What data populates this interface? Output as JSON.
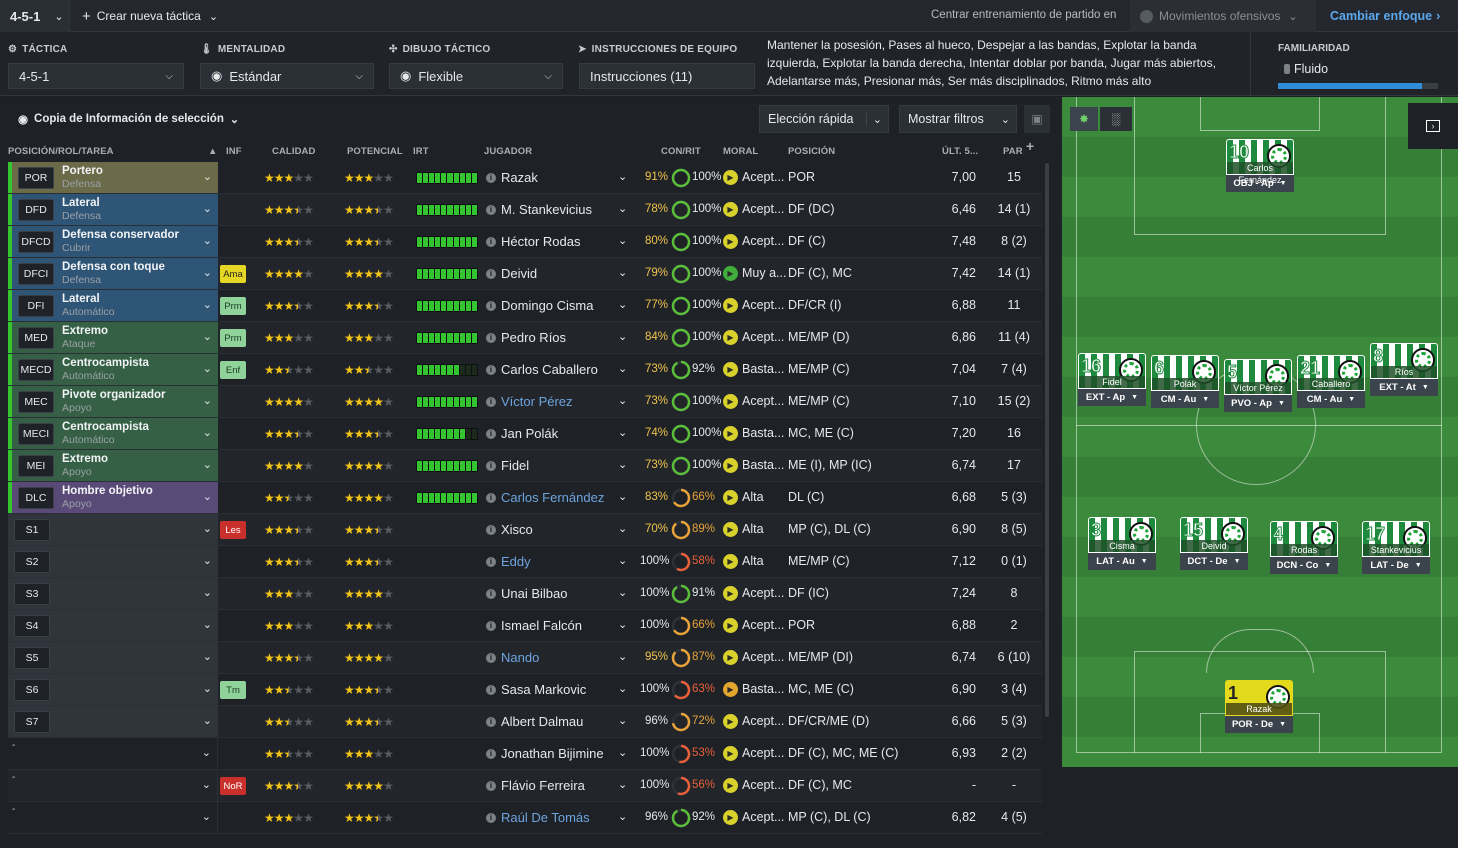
{
  "topbar": {
    "tactic_selected": "4-5-1",
    "create_new": "Crear nueva táctica",
    "match_training_label": "Centrar entrenamiento de partido en",
    "match_training_value": "Movimientos ofensivos",
    "change_focus": "Cambiar enfoque"
  },
  "tactic_nav": {
    "tactic_label": "TÁCTICA",
    "tactic_value": "4-5-1",
    "mentality_label": "MENTALIDAD",
    "mentality_value": "Estándar",
    "shape_label": "DIBUJO TÁCTICO",
    "shape_value": "Flexible",
    "instructions_label": "INSTRUCCIONES DE EQUIPO",
    "instructions_value": "Instrucciones (11)",
    "instructions_summary": "Mantener la posesión, Pases al hueco, Despejar a las bandas, Explotar la banda izquierda, Explotar la banda derecha, Intentar doblar por banda, Jugar más abiertos, Adelantarse más, Presionar más, Ser más disciplinados, Ritmo más alto",
    "familiarity_label": "FAMILIARIDAD",
    "familiarity_value": "Fluido",
    "familiarity_level": 0.9
  },
  "toolbar": {
    "copy_info": "Copia de Información de selección",
    "quick_pick": "Elección rápida",
    "show_filters": "Mostrar filtros"
  },
  "columns": {
    "role": "POSICIÓN/ROL/TAREA",
    "inf": "INF",
    "calidad": "CALIDAD",
    "potencial": "POTENCIAL",
    "irt": "IRT",
    "jugador": "JUGADOR",
    "con_rit": "CON/RIT",
    "moral": "MORAL",
    "posicion": "POSICIÓN",
    "ult5": "ÚLT. 5...",
    "par": "PAR"
  },
  "colors": {
    "gk": "#6b6a49",
    "def": "#2e5476",
    "mid": "#356046",
    "att": "#5a4a78",
    "sub": "#30353b",
    "stars": "#f2c318",
    "irt_bar": "#34c431",
    "link": "#6ea4de",
    "familiarity": "#2e8fd6"
  },
  "rows": [
    {
      "code": "POR",
      "role": "Portero",
      "duty": "Defensa",
      "group": "gk",
      "inf": "",
      "qual": 3,
      "pot": 3,
      "irt": 10,
      "name": "Razak",
      "link": false,
      "cond": "91%",
      "cond_c": "#f0c34a",
      "moral": "100%",
      "moral_c": "#5cbf3a",
      "mood": "Acept...",
      "mood_c": "#d9d12b",
      "pos": "POR",
      "ult": "7,00",
      "par": "15"
    },
    {
      "code": "DFD",
      "role": "Lateral",
      "duty": "Defensa",
      "group": "def",
      "inf": "",
      "qual": 3.5,
      "pot": 3.5,
      "irt": 10,
      "name": "M. Stankevicius",
      "link": false,
      "cond": "78%",
      "cond_c": "#f0c34a",
      "moral": "100%",
      "moral_c": "#5cbf3a",
      "mood": "Acept...",
      "mood_c": "#d9d12b",
      "pos": "DF (DC)",
      "ult": "6,46",
      "par": "14 (1)"
    },
    {
      "code": "DFCD",
      "role": "Defensa conservador",
      "duty": "Cubrir",
      "group": "def",
      "inf": "",
      "qual": 3.5,
      "pot": 3.5,
      "irt": 10,
      "name": "Héctor Rodas",
      "link": false,
      "cond": "80%",
      "cond_c": "#f0c34a",
      "moral": "100%",
      "moral_c": "#5cbf3a",
      "mood": "Acept...",
      "mood_c": "#d9d12b",
      "pos": "DF (C)",
      "ult": "7,48",
      "par": "8 (2)"
    },
    {
      "code": "DFCI",
      "role": "Defensa con toque",
      "duty": "Defensa",
      "group": "def",
      "inf": "Ama",
      "inf_bg": "#e6d725",
      "inf_c": "#222",
      "qual": 4,
      "pot": 4,
      "irt": 10,
      "name": "Deivid",
      "link": false,
      "cond": "79%",
      "cond_c": "#f0c34a",
      "moral": "100%",
      "moral_c": "#5cbf3a",
      "mood": "Muy a...",
      "mood_c": "#3fae3a",
      "pos": "DF (C), MC",
      "ult": "7,42",
      "par": "14 (1)"
    },
    {
      "code": "DFI",
      "role": "Lateral",
      "duty": "Automático",
      "group": "def",
      "inf": "Prm",
      "inf_bg": "#8fd39a",
      "inf_c": "#1d3b22",
      "qual": 3.5,
      "pot": 3.5,
      "irt": 10,
      "name": "Domingo Cisma",
      "link": false,
      "cond": "77%",
      "cond_c": "#f0c34a",
      "moral": "100%",
      "moral_c": "#5cbf3a",
      "mood": "Acept...",
      "mood_c": "#d9d12b",
      "pos": "DF/CR (I)",
      "ult": "6,88",
      "par": "11"
    },
    {
      "code": "MED",
      "role": "Extremo",
      "duty": "Ataque",
      "group": "mid",
      "inf": "Prm",
      "inf_bg": "#8fd39a",
      "inf_c": "#1d3b22",
      "qual": 3,
      "pot": 3,
      "irt": 10,
      "name": "Pedro Ríos",
      "link": false,
      "cond": "84%",
      "cond_c": "#f0c34a",
      "moral": "100%",
      "moral_c": "#5cbf3a",
      "mood": "Acept...",
      "mood_c": "#d9d12b",
      "pos": "ME/MP (D)",
      "ult": "6,86",
      "par": "11 (4)"
    },
    {
      "code": "MECD",
      "role": "Centrocampista",
      "duty": "Automático",
      "group": "mid",
      "inf": "Enf",
      "inf_bg": "#8fd39a",
      "inf_c": "#1d3b22",
      "qual": 2.5,
      "pot": 2.5,
      "irt": 7,
      "name": "Carlos Caballero",
      "link": false,
      "cond": "73%",
      "cond_c": "#f0c34a",
      "moral": "92%",
      "moral_c": "#5cbf3a",
      "mood": "Basta...",
      "mood_c": "#d9d12b",
      "pos": "ME/MP (C)",
      "ult": "7,04",
      "par": "7 (4)"
    },
    {
      "code": "MEC",
      "role": "Pivote organizador",
      "duty": "Apoyo",
      "group": "mid",
      "inf": "",
      "qual": 4,
      "pot": 4,
      "irt": 10,
      "name": "Víctor Pérez",
      "link": true,
      "cond": "73%",
      "cond_c": "#f0c34a",
      "moral": "100%",
      "moral_c": "#5cbf3a",
      "mood": "Acept...",
      "mood_c": "#d9d12b",
      "pos": "ME/MP (C)",
      "ult": "7,10",
      "par": "15 (2)"
    },
    {
      "code": "MECI",
      "role": "Centrocampista",
      "duty": "Automático",
      "group": "mid",
      "inf": "",
      "qual": 3.5,
      "pot": 3.5,
      "irt": 8,
      "name": "Jan Polák",
      "link": false,
      "cond": "74%",
      "cond_c": "#f0c34a",
      "moral": "100%",
      "moral_c": "#5cbf3a",
      "mood": "Basta...",
      "mood_c": "#d9d12b",
      "pos": "MC, ME (C)",
      "ult": "7,20",
      "par": "16"
    },
    {
      "code": "MEI",
      "role": "Extremo",
      "duty": "Apoyo",
      "group": "mid",
      "inf": "",
      "qual": 4,
      "pot": 4,
      "irt": 10,
      "name": "Fidel",
      "link": false,
      "cond": "73%",
      "cond_c": "#f0c34a",
      "moral": "100%",
      "moral_c": "#5cbf3a",
      "mood": "Basta...",
      "mood_c": "#d9d12b",
      "pos": "ME (I), MP (IC)",
      "ult": "6,74",
      "par": "17"
    },
    {
      "code": "DLC",
      "role": "Hombre objetivo",
      "duty": "Apoyo",
      "group": "att",
      "inf": "",
      "qual": 2.5,
      "pot": 4,
      "irt": 10,
      "name": "Carlos Fernández",
      "link": true,
      "cond": "83%",
      "cond_c": "#f0c34a",
      "moral": "66%",
      "moral_c": "#e8a23a",
      "mood": "Alta",
      "mood_c": "#d9d12b",
      "pos": "DL (C)",
      "ult": "6,68",
      "par": "5 (3)"
    },
    {
      "code": "S1",
      "role": "",
      "duty": "",
      "group": "sub",
      "inf": "Les",
      "inf_bg": "#c9302c",
      "inf_c": "#ffffff",
      "qual": 3.5,
      "pot": 3.5,
      "irt": 0,
      "name": "Xisco",
      "link": false,
      "cond": "70%",
      "cond_c": "#f0c34a",
      "moral": "89%",
      "moral_c": "#e8a23a",
      "mood": "Alta",
      "mood_c": "#d9d12b",
      "pos": "MP (C), DL (C)",
      "ult": "6,90",
      "par": "8 (5)"
    },
    {
      "code": "S2",
      "role": "",
      "duty": "",
      "group": "sub",
      "inf": "",
      "qual": 3.5,
      "pot": 3.5,
      "irt": 0,
      "name": "Eddy",
      "link": true,
      "cond": "100%",
      "cond_c": "#e6e8ea",
      "moral": "58%",
      "moral_c": "#e8603a",
      "mood": "Alta",
      "mood_c": "#d9d12b",
      "pos": "ME/MP (C)",
      "ult": "7,12",
      "par": "0 (1)"
    },
    {
      "code": "S3",
      "role": "",
      "duty": "",
      "group": "sub",
      "inf": "",
      "qual": 3,
      "pot": 4,
      "irt": 0,
      "name": "Unai Bilbao",
      "link": false,
      "cond": "100%",
      "cond_c": "#e6e8ea",
      "moral": "91%",
      "moral_c": "#5cbf3a",
      "mood": "Acept...",
      "mood_c": "#d9d12b",
      "pos": "DF (IC)",
      "ult": "7,24",
      "par": "8"
    },
    {
      "code": "S4",
      "role": "",
      "duty": "",
      "group": "sub",
      "inf": "",
      "qual": 3,
      "pot": 3,
      "irt": 0,
      "name": "Ismael Falcón",
      "link": false,
      "cond": "100%",
      "cond_c": "#e6e8ea",
      "moral": "66%",
      "moral_c": "#e8a23a",
      "mood": "Acept...",
      "mood_c": "#d9d12b",
      "pos": "POR",
      "ult": "6,88",
      "par": "2"
    },
    {
      "code": "S5",
      "role": "",
      "duty": "",
      "group": "sub",
      "inf": "",
      "qual": 3.5,
      "pot": 4,
      "irt": 0,
      "name": "Nando",
      "link": true,
      "cond": "95%",
      "cond_c": "#f0c34a",
      "moral": "87%",
      "moral_c": "#e8a23a",
      "mood": "Acept...",
      "mood_c": "#d9d12b",
      "pos": "ME/MP (DI)",
      "ult": "6,74",
      "par": "6 (10)"
    },
    {
      "code": "S6",
      "role": "",
      "duty": "",
      "group": "sub",
      "inf": "Tm",
      "inf_bg": "#8fd39a",
      "inf_c": "#1d3b22",
      "qual": 2.5,
      "pot": 3.5,
      "irt": 0,
      "name": "Sasa Markovic",
      "link": false,
      "cond": "100%",
      "cond_c": "#e6e8ea",
      "moral": "63%",
      "moral_c": "#e8603a",
      "mood": "Basta...",
      "mood_c": "#e3a72f",
      "pos": "MC, ME (C)",
      "ult": "6,90",
      "par": "3 (4)"
    },
    {
      "code": "S7",
      "role": "",
      "duty": "",
      "group": "sub",
      "inf": "",
      "qual": 2.5,
      "pot": 3.5,
      "irt": 0,
      "name": "Albert Dalmau",
      "link": false,
      "cond": "96%",
      "cond_c": "#e6e8ea",
      "moral": "72%",
      "moral_c": "#e8a23a",
      "mood": "Acept...",
      "mood_c": "#d9d12b",
      "pos": "DF/CR/ME (D)",
      "ult": "6,66",
      "par": "5 (3)"
    },
    {
      "code": "-",
      "role": "",
      "duty": "",
      "group": "none",
      "inf": "",
      "qual": 2.5,
      "pot": 3,
      "irt": 0,
      "name": "Jonathan Bijimine",
      "link": false,
      "cond": "100%",
      "cond_c": "#e6e8ea",
      "moral": "53%",
      "moral_c": "#e8603a",
      "mood": "Acept...",
      "mood_c": "#d9d12b",
      "pos": "DF (C), MC, ME (C)",
      "ult": "6,93",
      "par": "2 (2)"
    },
    {
      "code": "-",
      "role": "",
      "duty": "",
      "group": "none",
      "inf": "NoR",
      "inf_bg": "#c9302c",
      "inf_c": "#ffffff",
      "qual": 3.5,
      "pot": 4,
      "irt": 0,
      "name": "Flávio Ferreira",
      "link": false,
      "cond": "100%",
      "cond_c": "#e6e8ea",
      "moral": "56%",
      "moral_c": "#e8603a",
      "mood": "Acept...",
      "mood_c": "#d9d12b",
      "pos": "DF (C), MC",
      "ult": "-",
      "par": "-"
    },
    {
      "code": "-",
      "role": "",
      "duty": "",
      "group": "none",
      "inf": "",
      "qual": 3,
      "pot": 3.5,
      "irt": 0,
      "name": "Raúl De Tomás",
      "link": true,
      "cond": "96%",
      "cond_c": "#e6e8ea",
      "moral": "92%",
      "moral_c": "#5cbf3a",
      "mood": "Acept...",
      "mood_c": "#d9d12b",
      "pos": "MP (C), DL (C)",
      "ult": "6,82",
      "par": "4 (5)"
    }
  ],
  "pitch_players": [
    {
      "num": "10",
      "name": "Carlos Fernández",
      "role": "OBJ - Ap",
      "gk": false
    },
    {
      "num": "16",
      "name": "Fidel",
      "role": "EXT - Ap",
      "gk": false
    },
    {
      "num": "6",
      "name": "Polák",
      "role": "CM - Au",
      "gk": false
    },
    {
      "num": "5",
      "name": "Víctor Pérez",
      "role": "PVO - Ap",
      "gk": false
    },
    {
      "num": "21",
      "name": "Caballero",
      "role": "CM - Au",
      "gk": false
    },
    {
      "num": "8",
      "name": "Ríos",
      "role": "EXT - At",
      "gk": false
    },
    {
      "num": "3",
      "name": "Cisma",
      "role": "LAT - Au",
      "gk": false
    },
    {
      "num": "15",
      "name": "Deivid",
      "role": "DCT - De",
      "gk": false
    },
    {
      "num": "4",
      "name": "Rodas",
      "role": "DCN - Co",
      "gk": false
    },
    {
      "num": "17",
      "name": "Stankevicius",
      "role": "LAT - De",
      "gk": false
    },
    {
      "num": "1",
      "name": "Razak",
      "role": "POR - De",
      "gk": true
    }
  ]
}
